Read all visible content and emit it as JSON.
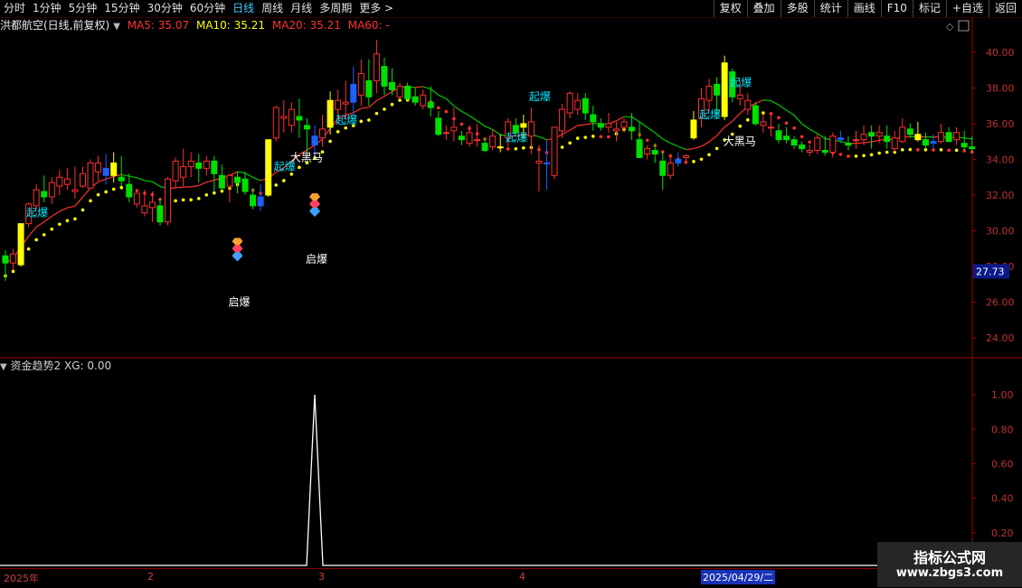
{
  "toolbar": {
    "periods": [
      "分时",
      "1分钟",
      "5分钟",
      "15分钟",
      "30分钟",
      "60分钟",
      "日线",
      "周线",
      "月线",
      "多周期",
      "更多 >"
    ],
    "actions": [
      "复权",
      "叠加",
      "多股",
      "统计",
      "画线",
      "F10",
      "标记",
      "+自选",
      "返回"
    ]
  },
  "info": {
    "title": "洪都航空(日线,前复权)",
    "ma5": "MA5: 35.07",
    "ma10": "MA10: 35.21",
    "ma20": "MA20: 35.21",
    "ma60": "MA60: -"
  },
  "colors": {
    "up": "#ff3030",
    "down": "#00e000",
    "signal_up": "#ffff00",
    "signal_down": "#1e5fff",
    "ma": "#ff3030",
    "ma_down": "#00c800",
    "dots_red": "#ff3030",
    "dots_yellow": "#ffff00",
    "label": "#00e5ff",
    "axis": "#a00000"
  },
  "price_axis": {
    "ticks": [
      "40.00",
      "38.00",
      "36.00",
      "34.00",
      "32.00",
      "30.00",
      "28.00",
      "26.00",
      "24.00"
    ],
    "current": "27.73"
  },
  "sub_info": {
    "title": "资金趋势2",
    "xg": "XG: 0.00"
  },
  "sub_axis": {
    "ticks": [
      "1.00",
      "0.80",
      "0.60",
      "0.40",
      "0.20"
    ]
  },
  "date_axis": {
    "labels": [
      "2025年",
      "2",
      "3",
      "4"
    ],
    "cursor": "2025/04/29/二"
  },
  "annotations": {
    "qibao": "起爆",
    "qibao2": "启爆",
    "heima": "大黑马"
  },
  "watermark": {
    "line1": "指标公式网",
    "line2": "www.zbgs3.com"
  },
  "chart_data": {
    "type": "candlestick",
    "ylim": [
      23,
      41
    ],
    "candles": [
      [
        28.6,
        28.9,
        27.2,
        28.2
      ],
      [
        28.2,
        29.0,
        27.8,
        28.7
      ],
      [
        28.1,
        30.4,
        28.0,
        30.4
      ],
      [
        30.4,
        31.6,
        30.2,
        31.5
      ],
      [
        31.4,
        32.6,
        31.2,
        32.3
      ],
      [
        32.2,
        33.1,
        31.6,
        31.9
      ],
      [
        31.9,
        33.0,
        31.5,
        32.7
      ],
      [
        32.5,
        33.4,
        32.0,
        33.0
      ],
      [
        32.6,
        33.5,
        32.3,
        32.9
      ],
      [
        32.2,
        33.6,
        31.8,
        32.3
      ],
      [
        32.5,
        33.6,
        32.4,
        33.2
      ],
      [
        32.4,
        34.0,
        32.5,
        33.8
      ],
      [
        33.3,
        34.2,
        32.8,
        33.8
      ],
      [
        33.5,
        34.3,
        32.6,
        33.1
      ],
      [
        33.1,
        34.4,
        32.7,
        33.8
      ],
      [
        33.0,
        34.2,
        32.5,
        32.8
      ],
      [
        32.6,
        33.2,
        31.6,
        31.9
      ],
      [
        31.5,
        32.0,
        31.3,
        32.1
      ],
      [
        31.0,
        32.3,
        30.8,
        31.4
      ],
      [
        31.3,
        32.2,
        30.5,
        31.6
      ],
      [
        31.4,
        31.8,
        30.3,
        30.5
      ],
      [
        30.5,
        33.0,
        30.3,
        32.9
      ],
      [
        32.8,
        34.1,
        32.4,
        33.9
      ],
      [
        33.0,
        34.6,
        32.5,
        33.6
      ],
      [
        33.6,
        34.4,
        33.0,
        33.9
      ],
      [
        33.8,
        34.3,
        32.7,
        33.5
      ],
      [
        33.5,
        34.2,
        33.1,
        33.9
      ],
      [
        33.9,
        34.2,
        32.2,
        33.2
      ],
      [
        33.1,
        33.7,
        32.3,
        32.4
      ],
      [
        32.5,
        33.2,
        31.6,
        33.1
      ],
      [
        33.0,
        33.3,
        32.1,
        32.7
      ],
      [
        32.9,
        33.3,
        32.0,
        32.2
      ],
      [
        32.0,
        32.4,
        31.2,
        31.4
      ],
      [
        31.4,
        32.6,
        31.1,
        31.9
      ],
      [
        32.0,
        35.0,
        31.9,
        35.1
      ],
      [
        35.2,
        37.0,
        35.0,
        36.9
      ],
      [
        36.3,
        37.3,
        35.5,
        36.4
      ],
      [
        35.9,
        37.2,
        35.5,
        36.8
      ],
      [
        36.4,
        37.4,
        35.2,
        36.2
      ],
      [
        35.9,
        36.3,
        34.4,
        35.7
      ],
      [
        34.8,
        35.9,
        34.2,
        35.3
      ],
      [
        35.2,
        36.5,
        34.7,
        35.7
      ],
      [
        35.8,
        37.8,
        35.4,
        37.3
      ],
      [
        36.8,
        37.9,
        36.3,
        37.3
      ],
      [
        37.1,
        38.4,
        36.2,
        37.2
      ],
      [
        37.2,
        39.2,
        36.5,
        38.2
      ],
      [
        37.6,
        39.6,
        37.0,
        38.8
      ],
      [
        38.4,
        39.6,
        37.0,
        37.5
      ],
      [
        38.4,
        40.7,
        37.7,
        39.9
      ],
      [
        39.2,
        39.7,
        37.6,
        38.1
      ],
      [
        38.3,
        39.1,
        37.6,
        37.9
      ],
      [
        37.5,
        38.3,
        37.4,
        38.1
      ],
      [
        38.1,
        38.3,
        37.3,
        37.4
      ],
      [
        37.5,
        38.0,
        37.0,
        37.2
      ],
      [
        37.0,
        37.9,
        36.8,
        37.6
      ],
      [
        37.2,
        38.1,
        36.4,
        36.9
      ],
      [
        36.3,
        36.7,
        35.3,
        35.4
      ],
      [
        35.5,
        35.9,
        35.1,
        35.5
      ],
      [
        35.6,
        36.9,
        35.0,
        35.8
      ],
      [
        35.3,
        35.6,
        34.8,
        35.1
      ],
      [
        34.9,
        35.9,
        34.7,
        35.5
      ],
      [
        35.1,
        36.0,
        34.7,
        35.1
      ],
      [
        34.9,
        35.2,
        34.4,
        34.5
      ],
      [
        34.7,
        35.7,
        34.5,
        35.3
      ],
      [
        34.7,
        35.4,
        34.4,
        34.7
      ],
      [
        35.2,
        36.3,
        34.7,
        36.1
      ],
      [
        35.9,
        36.3,
        35.4,
        35.5
      ],
      [
        35.8,
        36.5,
        35.1,
        36.0
      ],
      [
        35.3,
        36.9,
        34.3,
        36.1
      ],
      [
        33.8,
        34.8,
        32.2,
        33.9
      ],
      [
        33.8,
        35.1,
        32.3,
        33.8
      ],
      [
        33.1,
        35.8,
        32.9,
        35.8
      ],
      [
        35.6,
        37.1,
        35.2,
        36.8
      ],
      [
        36.6,
        37.8,
        36.3,
        37.7
      ],
      [
        36.8,
        37.7,
        36.5,
        37.3
      ],
      [
        37.4,
        37.7,
        36.2,
        36.6
      ],
      [
        36.5,
        37.0,
        35.6,
        36.1
      ],
      [
        36.0,
        36.3,
        35.6,
        35.8
      ],
      [
        35.8,
        36.6,
        35.5,
        36.0
      ],
      [
        35.6,
        36.1,
        35.0,
        35.7
      ],
      [
        35.8,
        36.3,
        35.5,
        36.1
      ],
      [
        35.8,
        36.6,
        35.1,
        35.6
      ],
      [
        35.1,
        36.1,
        34.1,
        34.1
      ],
      [
        34.3,
        34.8,
        34.0,
        34.6
      ],
      [
        34.5,
        34.9,
        33.8,
        34.3
      ],
      [
        33.9,
        34.4,
        32.3,
        33.1
      ],
      [
        33.1,
        34.3,
        32.9,
        33.8
      ],
      [
        33.8,
        34.4,
        33.6,
        34.0
      ],
      [
        34.1,
        34.3,
        33.9,
        34.2
      ],
      [
        35.2,
        36.7,
        35.1,
        36.2
      ],
      [
        36.3,
        38.0,
        35.8,
        37.4
      ],
      [
        37.3,
        38.5,
        36.7,
        38.1
      ],
      [
        38.2,
        38.6,
        36.5,
        37.6
      ],
      [
        36.4,
        39.8,
        36.2,
        39.4
      ],
      [
        38.9,
        39.1,
        37.2,
        37.5
      ],
      [
        37.4,
        38.4,
        37.0,
        37.6
      ],
      [
        36.8,
        37.7,
        36.5,
        37.3
      ],
      [
        37.0,
        37.2,
        35.9,
        36.0
      ],
      [
        35.9,
        36.5,
        35.5,
        36.1
      ],
      [
        35.8,
        36.5,
        35.3,
        35.8
      ],
      [
        35.6,
        36.0,
        34.9,
        35.1
      ],
      [
        35.3,
        35.8,
        34.9,
        35.1
      ],
      [
        35.1,
        35.3,
        34.6,
        34.8
      ],
      [
        34.8,
        35.0,
        34.4,
        34.6
      ],
      [
        34.4,
        34.8,
        34.2,
        34.5
      ],
      [
        34.5,
        35.4,
        34.3,
        35.2
      ],
      [
        34.5,
        35.3,
        34.2,
        34.4
      ],
      [
        34.4,
        35.5,
        34.1,
        35.3
      ],
      [
        35.1,
        35.6,
        34.9,
        35.2
      ],
      [
        34.9,
        35.3,
        34.5,
        34.8
      ],
      [
        35.1,
        35.6,
        34.6,
        35.1
      ],
      [
        35.1,
        35.9,
        34.8,
        35.4
      ],
      [
        35.5,
        35.9,
        34.6,
        35.3
      ],
      [
        35.3,
        35.9,
        34.9,
        35.5
      ],
      [
        35.3,
        35.9,
        34.6,
        35.0
      ],
      [
        34.6,
        35.6,
        34.4,
        35.2
      ],
      [
        35.0,
        36.3,
        34.9,
        35.8
      ],
      [
        35.7,
        36.0,
        35.2,
        35.4
      ],
      [
        35.4,
        36.1,
        35.0,
        35.1
      ],
      [
        35.1,
        35.5,
        34.6,
        34.8
      ],
      [
        34.9,
        35.4,
        34.6,
        35.0
      ],
      [
        35.0,
        36.0,
        34.9,
        35.5
      ],
      [
        35.5,
        35.8,
        35.0,
        35.0
      ],
      [
        35.1,
        35.8,
        34.8,
        35.5
      ],
      [
        34.9,
        35.6,
        34.5,
        34.7
      ],
      [
        34.7,
        35.3,
        34.4,
        34.6
      ]
    ],
    "signal_up": [
      2,
      14,
      34,
      42,
      64,
      67,
      89,
      93,
      118
    ],
    "signal_down": [
      13,
      33,
      40,
      45,
      70,
      87,
      108,
      120
    ],
    "labels": [
      {
        "text_key": "qibao",
        "i": 2,
        "v": 30.8
      },
      {
        "text_key": "qibao",
        "i": 34,
        "v": 33.4
      },
      {
        "text_key": "qibao",
        "i": 42,
        "v": 36.0
      },
      {
        "text_key": "qibao",
        "i": 64,
        "v": 35.0
      },
      {
        "text_key": "qibao",
        "i": 67,
        "v": 37.3
      },
      {
        "text_key": "qibao",
        "i": 89,
        "v": 36.3
      },
      {
        "text_key": "qibao",
        "i": 93,
        "v": 38.1
      },
      {
        "text_key": "heima",
        "i": 38,
        "v": 33.9
      },
      {
        "text_key": "heima",
        "i": 94,
        "v": 34.8
      },
      {
        "text_key": "qibao2",
        "i": 30,
        "v": 25.8
      },
      {
        "text_key": "qibao2",
        "i": 40,
        "v": 28.2
      }
    ],
    "gems": [
      30,
      40
    ],
    "sub_spike": {
      "index": 40,
      "value": 1.0,
      "ylim": [
        0,
        1.1
      ]
    }
  }
}
